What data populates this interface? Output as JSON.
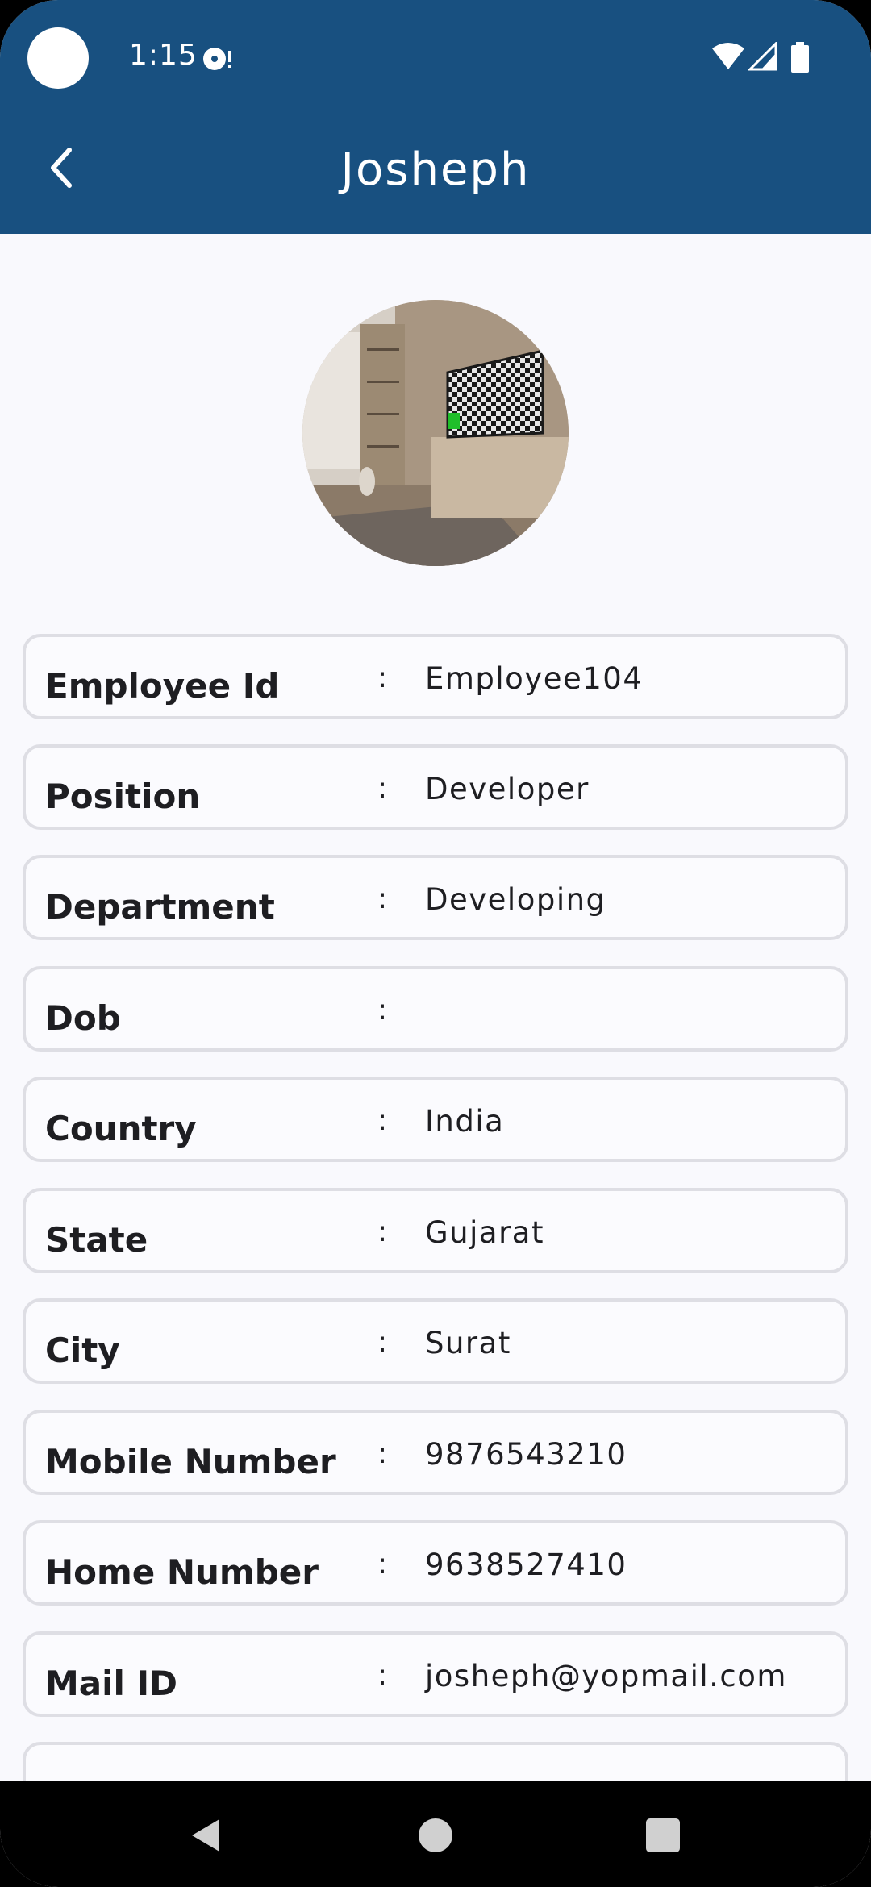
{
  "status_bar": {
    "time": "1:15",
    "icons": [
      "disk-icon",
      "wifi-icon",
      "signal-icon",
      "battery-icon"
    ]
  },
  "header": {
    "back_icon": "chevron-left-icon",
    "title": "Josheph",
    "background_color": "#185080"
  },
  "profile": {
    "avatar": "room-photo-avatar"
  },
  "fields": [
    {
      "label": "Employee Id",
      "separator": ":",
      "value": "Employee104"
    },
    {
      "label": "Position",
      "separator": ":",
      "value": "Developer"
    },
    {
      "label": "Department",
      "separator": ":",
      "value": "Developing"
    },
    {
      "label": "Dob",
      "separator": ":",
      "value": ""
    },
    {
      "label": "Country",
      "separator": ":",
      "value": "India"
    },
    {
      "label": "State",
      "separator": ":",
      "value": "Gujarat"
    },
    {
      "label": "City",
      "separator": ":",
      "value": "Surat"
    },
    {
      "label": "Mobile Number",
      "separator": ":",
      "value": "9876543210"
    },
    {
      "label": "Home Number",
      "separator": ":",
      "value": "9638527410"
    },
    {
      "label": "Mail ID",
      "separator": ":",
      "value": "josheph@yopmail.com"
    }
  ],
  "nav_bar": {
    "buttons": [
      "nav-back-icon",
      "nav-home-icon",
      "nav-recents-icon"
    ]
  }
}
